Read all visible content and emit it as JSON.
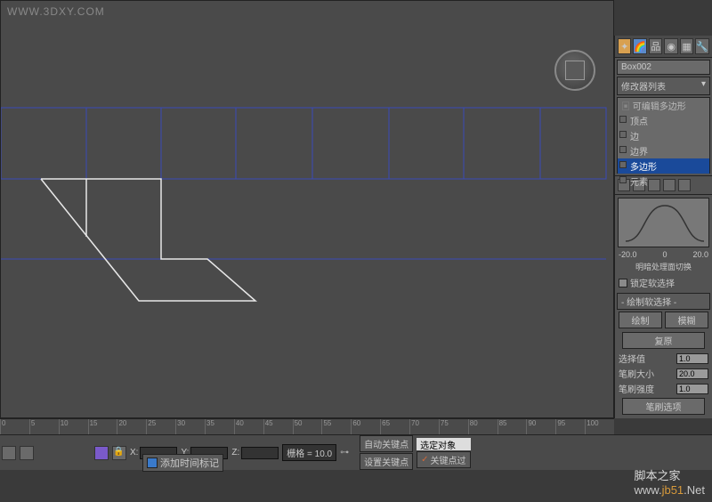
{
  "watermarks": {
    "top_left": "WWW.3DXY.COM",
    "bottom_right_1": "脚本之家",
    "bottom_right_2": "www.",
    "bottom_right_3": "jb51",
    "bottom_right_4": ".Net"
  },
  "object_name": "Box002",
  "modifier_header": "修改器列表",
  "modifier_stack": {
    "top": "可编辑多边形",
    "items": [
      "顶点",
      "边",
      "边界",
      "多边形",
      "元素"
    ],
    "selected_index": 3
  },
  "soft_sel": {
    "graph_min": "-20.0",
    "graph_zero": "0",
    "graph_max": "20.0",
    "caption": "明暗处理面切换",
    "lock_label": "锁定软选择",
    "paint_header": "绘制软选择",
    "paint_btn": "绘制",
    "blur_btn": "模糊",
    "revert_btn": "复原",
    "value_label": "选择值",
    "value": "1.0",
    "brush_size_label": "笔刷大小",
    "brush_size": "20.0",
    "brush_str_label": "笔刷强度",
    "brush_str": "1.0",
    "options_btn": "笔刷选项"
  },
  "timeline": {
    "ticks": [
      "0",
      "5",
      "10",
      "15",
      "20",
      "25",
      "30",
      "35",
      "40",
      "45",
      "50",
      "55",
      "60",
      "65",
      "70",
      "75",
      "80",
      "85",
      "90",
      "95",
      "100"
    ]
  },
  "bottom": {
    "x_label": "X:",
    "y_label": "Y:",
    "z_label": "Z:",
    "grid_label": "栅格 = 10.0",
    "auto_key": "自动关键点",
    "set_key": "设置关键点",
    "selected_obj": "选定对象",
    "key_filter": "关键点过",
    "add_tag": "添加时间标记"
  }
}
